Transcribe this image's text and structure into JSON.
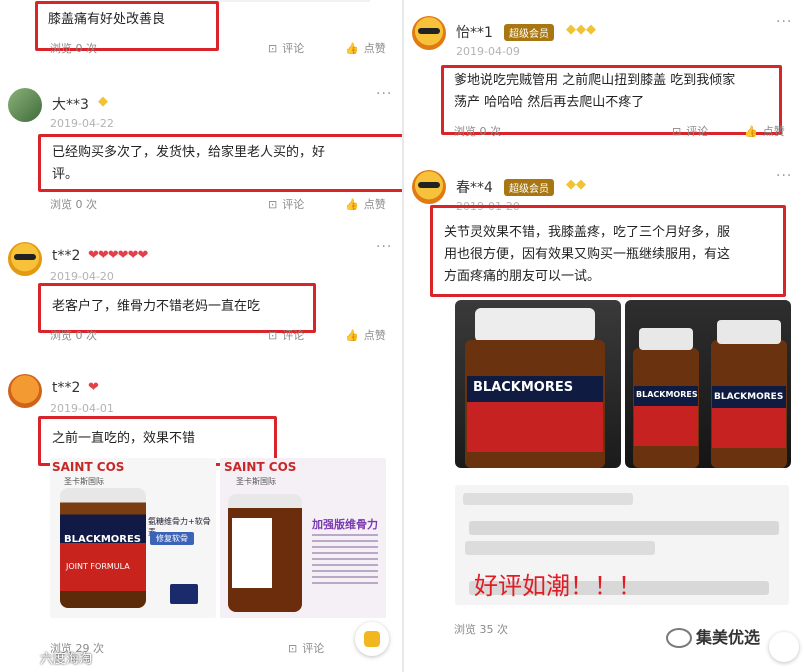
{
  "left": {
    "top_comment": {
      "text": "膝盖痛有好处改善良",
      "views": "浏览 0 次",
      "comment_label": "评论",
      "like_label": "点赞"
    },
    "comments": [
      {
        "user": "大**3",
        "date": "2019-04-22",
        "text_line1": "已经购买多次了，发货快，给家里老人买的，好",
        "text_line2": "评。",
        "views": "浏览 0 次",
        "comment_label": "评论",
        "like_label": "点赞"
      },
      {
        "user": "t**2",
        "date": "2019-04-20",
        "text": "老客户了，维骨力不错老妈一直在吃",
        "views": "浏览 0 次",
        "comment_label": "评论",
        "like_label": "点赞"
      },
      {
        "user": "t**2",
        "date": "2019-04-01",
        "text": "之前一直吃的，效果不错",
        "views": "浏览 29 次",
        "comment_label": "评论"
      }
    ],
    "ads": [
      {
        "brand": "SAINT COS",
        "sub": "圣卡斯国际",
        "product": "BLACKMORES",
        "product_sub": "JOINT FORMULA",
        "line1": "氨糖维骨力+软骨素",
        "pill": "修复软骨"
      },
      {
        "brand": "SAINT COS",
        "sub": "圣卡斯国际",
        "title": "加强版维骨力"
      }
    ],
    "watermark": "六度海淘"
  },
  "right": {
    "comments": [
      {
        "user": "怡**1",
        "badge": "超级会员",
        "date": "2019-04-09",
        "text_line1": "爹地说吃完贼管用 之前爬山扭到膝盖 吃到我倾家",
        "text_line2": "荡产 哈哈哈 然后再去爬山不疼了",
        "views": "浏览 0 次",
        "comment_label": "评论",
        "like_label": "点赞"
      },
      {
        "user": "春**4",
        "badge": "超级会员",
        "date": "2019-01-20",
        "text_line1": "关节灵效果不错，我膝盖疼，吃了三个月好多，服",
        "text_line2": "用也很方便，因有效果又购买一瓶继续服用，有这",
        "text_line3": "方面疼痛的朋友可以一试。",
        "views": "浏览 35 次"
      }
    ],
    "photo_labels": [
      "BLACKMORES",
      "BLACKMORES",
      "BLACKMORES"
    ],
    "banner": "好评如潮！！！",
    "watermark": "集美优选"
  },
  "colors": {
    "red": "#d9242a",
    "gold": "#a97712",
    "heart": "#e2414a",
    "diamond": "#f1c232"
  }
}
